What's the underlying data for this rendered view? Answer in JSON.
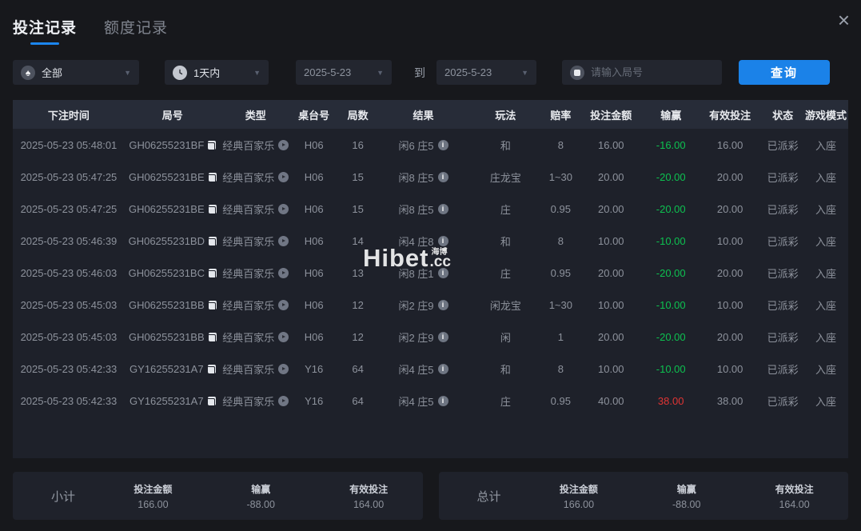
{
  "window": {
    "close_glyph": "×"
  },
  "tabs": [
    {
      "label": "投注记录",
      "active": true
    },
    {
      "label": "额度记录",
      "active": false
    }
  ],
  "filters": {
    "game_type": "全部",
    "time_range": "1天内",
    "date_from": "2025-5-23",
    "to_label": "到",
    "date_to": "2025-5-23",
    "search_placeholder": "请输入局号",
    "query_label": "查询"
  },
  "table": {
    "columns": [
      "下注时间",
      "局号",
      "类型",
      "桌台号",
      "局数",
      "结果",
      "玩法",
      "赔率",
      "投注金额",
      "输赢",
      "有效投注",
      "状态",
      "游戏模式"
    ],
    "rows": [
      {
        "time": "2025-05-23 05:48:01",
        "game_id": "GH06255231BF",
        "type": "经典百家乐",
        "table_no": "H06",
        "round": "16",
        "result": "闲6 庄5",
        "play": "和",
        "odds": "8",
        "bet": "16.00",
        "win": "-16.00",
        "valid": "16.00",
        "status": "已派彩",
        "mode": "入座"
      },
      {
        "time": "2025-05-23 05:47:25",
        "game_id": "GH06255231BE",
        "type": "经典百家乐",
        "table_no": "H06",
        "round": "15",
        "result": "闲8 庄5",
        "play": "庄龙宝",
        "odds": "1~30",
        "bet": "20.00",
        "win": "-20.00",
        "valid": "20.00",
        "status": "已派彩",
        "mode": "入座"
      },
      {
        "time": "2025-05-23 05:47:25",
        "game_id": "GH06255231BE",
        "type": "经典百家乐",
        "table_no": "H06",
        "round": "15",
        "result": "闲8 庄5",
        "play": "庄",
        "odds": "0.95",
        "bet": "20.00",
        "win": "-20.00",
        "valid": "20.00",
        "status": "已派彩",
        "mode": "入座"
      },
      {
        "time": "2025-05-23 05:46:39",
        "game_id": "GH06255231BD",
        "type": "经典百家乐",
        "table_no": "H06",
        "round": "14",
        "result": "闲4 庄8",
        "play": "和",
        "odds": "8",
        "bet": "10.00",
        "win": "-10.00",
        "valid": "10.00",
        "status": "已派彩",
        "mode": "入座"
      },
      {
        "time": "2025-05-23 05:46:03",
        "game_id": "GH06255231BC",
        "type": "经典百家乐",
        "table_no": "H06",
        "round": "13",
        "result": "闲8 庄1",
        "play": "庄",
        "odds": "0.95",
        "bet": "20.00",
        "win": "-20.00",
        "valid": "20.00",
        "status": "已派彩",
        "mode": "入座"
      },
      {
        "time": "2025-05-23 05:45:03",
        "game_id": "GH06255231BB",
        "type": "经典百家乐",
        "table_no": "H06",
        "round": "12",
        "result": "闲2 庄9",
        "play": "闲龙宝",
        "odds": "1~30",
        "bet": "10.00",
        "win": "-10.00",
        "valid": "10.00",
        "status": "已派彩",
        "mode": "入座"
      },
      {
        "time": "2025-05-23 05:45:03",
        "game_id": "GH06255231BB",
        "type": "经典百家乐",
        "table_no": "H06",
        "round": "12",
        "result": "闲2 庄9",
        "play": "闲",
        "odds": "1",
        "bet": "20.00",
        "win": "-20.00",
        "valid": "20.00",
        "status": "已派彩",
        "mode": "入座"
      },
      {
        "time": "2025-05-23 05:42:33",
        "game_id": "GY16255231A7",
        "type": "经典百家乐",
        "table_no": "Y16",
        "round": "64",
        "result": "闲4 庄5",
        "play": "和",
        "odds": "8",
        "bet": "10.00",
        "win": "-10.00",
        "valid": "10.00",
        "status": "已派彩",
        "mode": "入座"
      },
      {
        "time": "2025-05-23 05:42:33",
        "game_id": "GY16255231A7",
        "type": "经典百家乐",
        "table_no": "Y16",
        "round": "64",
        "result": "闲4 庄5",
        "play": "庄",
        "odds": "0.95",
        "bet": "40.00",
        "win": "38.00",
        "valid": "38.00",
        "status": "已派彩",
        "mode": "入座"
      }
    ]
  },
  "watermark": {
    "brand": "Hibet",
    "domain": ".cc",
    "cn": "海博"
  },
  "summary": {
    "columns": [
      "投注金额",
      "输赢",
      "有效投注"
    ],
    "subtotal": {
      "label": "小计",
      "bet_amount": "166.00",
      "win_loss": "-88.00",
      "valid_bet": "164.00"
    },
    "total": {
      "label": "总计",
      "bet_amount": "166.00",
      "win_loss": "-88.00",
      "valid_bet": "164.00"
    }
  },
  "colors": {
    "accent": "#1b82e8",
    "loss_green": "#0dc150",
    "win_red": "#e03434"
  }
}
